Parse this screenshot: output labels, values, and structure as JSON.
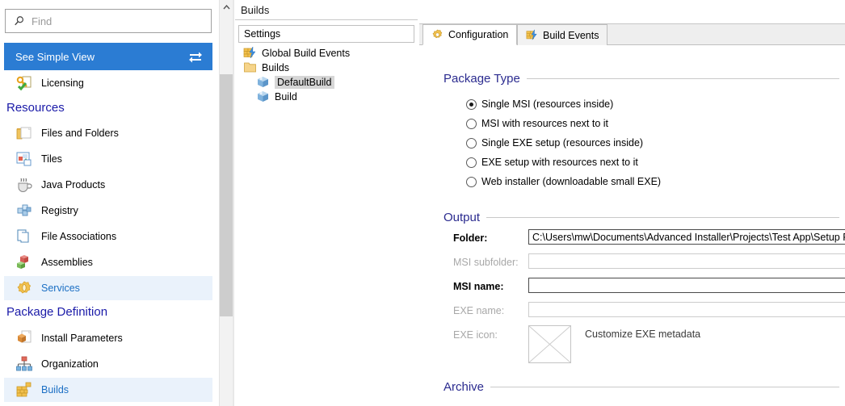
{
  "sidebar": {
    "search": {
      "placeholder": "Find",
      "value": "",
      "icon": "search-icon"
    },
    "simple_view": {
      "label": "See Simple View",
      "icon": "switch-view-icon"
    },
    "top_items": [
      {
        "label": "Licensing",
        "icon": "key-check-icon",
        "selected": false
      }
    ],
    "sections": [
      {
        "title": "Resources",
        "items": [
          {
            "label": "Files and Folders",
            "icon": "folder-open-icon",
            "selected": false
          },
          {
            "label": "Tiles",
            "icon": "tiles-icon",
            "selected": false
          },
          {
            "label": "Java Products",
            "icon": "coffee-cup-icon",
            "selected": false
          },
          {
            "label": "Registry",
            "icon": "registry-blocks-icon",
            "selected": false
          },
          {
            "label": "File Associations",
            "icon": "file-pages-icon",
            "selected": false
          },
          {
            "label": "Assemblies",
            "icon": "assemblies-cubes-icon",
            "selected": false
          },
          {
            "label": "Services",
            "icon": "gear-services-icon",
            "selected": true
          }
        ]
      },
      {
        "title": "Package Definition",
        "items": [
          {
            "label": "Install Parameters",
            "icon": "package-page-icon",
            "selected": false
          },
          {
            "label": "Organization",
            "icon": "org-chart-icon",
            "selected": false
          },
          {
            "label": "Builds",
            "icon": "brick-wall-icon",
            "selected": true
          }
        ]
      }
    ],
    "scrollbar": {
      "up_arrow": "chevron-up-icon"
    }
  },
  "tree_panel": {
    "title": "Builds",
    "column_header": "Settings",
    "nodes": [
      {
        "label": "Global Build Events",
        "icon": "build-events-icon",
        "indent": 0,
        "selected": false
      },
      {
        "label": "Builds",
        "icon": "folder-icon",
        "indent": 0,
        "selected": false
      },
      {
        "label": "DefaultBuild",
        "icon": "build-cube-icon",
        "indent": 1,
        "selected": true
      },
      {
        "label": "Build",
        "icon": "build-cube-icon",
        "indent": 1,
        "selected": false
      }
    ]
  },
  "right_panel": {
    "tabs": [
      {
        "label": "Configuration",
        "icon": "gear-icon",
        "active": true
      },
      {
        "label": "Build Events",
        "icon": "build-events-icon",
        "active": false
      }
    ],
    "groups": {
      "package_type": {
        "title": "Package Type",
        "options": [
          {
            "label": "Single MSI (resources inside)",
            "selected": true
          },
          {
            "label": "MSI with resources next to it",
            "selected": false
          },
          {
            "label": "Single EXE setup (resources inside)",
            "selected": false
          },
          {
            "label": "EXE setup with resources next to it",
            "selected": false
          },
          {
            "label": "Web installer (downloadable small EXE)",
            "selected": false
          }
        ]
      },
      "output": {
        "title": "Output",
        "fields": [
          {
            "label": "Folder:",
            "value": "C:\\Users\\mw\\Documents\\Advanced Installer\\Projects\\Test App\\Setup Files",
            "enabled": true
          },
          {
            "label": "MSI subfolder:",
            "value": "",
            "enabled": false
          },
          {
            "label": "MSI name:",
            "value": "",
            "enabled": true
          },
          {
            "label": "EXE name:",
            "value": "",
            "enabled": false
          }
        ],
        "exe_icon_label": "EXE icon:",
        "exe_icon_placeholder": "empty-image-icon",
        "customize_link": "Customize EXE metadata"
      },
      "archive": {
        "title": "Archive"
      }
    }
  },
  "colors": {
    "accent_blue": "#2b7cd3",
    "section_header": "#1a1aa8",
    "group_header": "#2b2b8f",
    "selected_row_bg": "#eaf2fb",
    "selected_row_text": "#1b6fc4",
    "tree_selection_bg": "#d6d6d6"
  }
}
